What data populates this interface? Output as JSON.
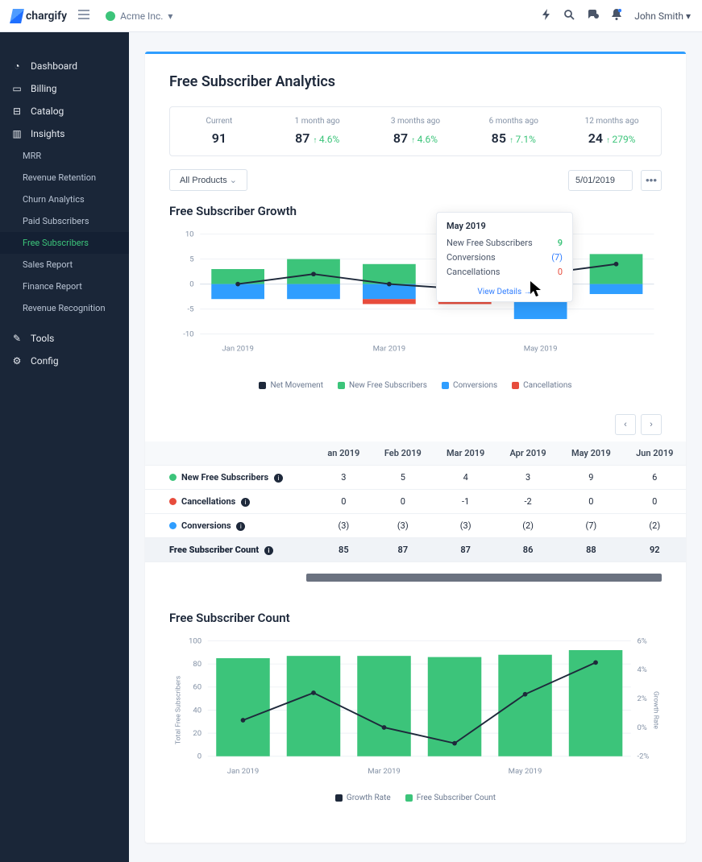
{
  "brand": "chargify",
  "org": "Acme Inc.",
  "user": "John Smith",
  "sidebar": {
    "items": [
      {
        "icon": "dashboard",
        "label": "Dashboard"
      },
      {
        "icon": "billing",
        "label": "Billing"
      },
      {
        "icon": "catalog",
        "label": "Catalog"
      },
      {
        "icon": "insights",
        "label": "Insights"
      },
      {
        "icon": "tools",
        "label": "Tools"
      },
      {
        "icon": "config",
        "label": "Config"
      }
    ],
    "insights_subs": [
      "MRR",
      "Revenue Retention",
      "Churn Analytics",
      "Paid Subscribers",
      "Free Subscribers",
      "Sales Report",
      "Finance Report",
      "Revenue Recognition"
    ]
  },
  "page": {
    "title": "Free Subscriber Analytics"
  },
  "kpis": [
    {
      "label": "Current",
      "value": "91",
      "delta": ""
    },
    {
      "label": "1 month ago",
      "value": "87",
      "delta": "4.6%"
    },
    {
      "label": "3 months ago",
      "value": "87",
      "delta": "4.6%"
    },
    {
      "label": "6 months ago",
      "value": "85",
      "delta": "7.1%"
    },
    {
      "label": "12 months ago",
      "value": "24",
      "delta": "279%"
    }
  ],
  "filters": {
    "products": "All Products",
    "date_end": "5/01/2019"
  },
  "growth": {
    "title": "Free Subscriber Growth",
    "legend": [
      "Net Movement",
      "New Free Subscribers",
      "Conversions",
      "Cancellations"
    ]
  },
  "tooltip": {
    "title": "May 2019",
    "rows": [
      {
        "label": "New Free Subscribers",
        "value": "9",
        "cls": "green"
      },
      {
        "label": "Conversions",
        "value": "(7)",
        "cls": "blue"
      },
      {
        "label": "Cancellations",
        "value": "0",
        "cls": "red"
      }
    ],
    "link": "View Details →"
  },
  "table": {
    "cols": [
      "an 2019",
      "Feb 2019",
      "Mar 2019",
      "Apr 2019",
      "May 2019",
      "Jun 2019"
    ],
    "rows": [
      {
        "label": "New Free Subscribers",
        "color": "#3cc47a",
        "vals": [
          "3",
          "5",
          "4",
          "3",
          "9",
          "6"
        ]
      },
      {
        "label": "Cancellations",
        "color": "#e74c3c",
        "vals": [
          "0",
          "0",
          "-1",
          "-2",
          "0",
          "0"
        ]
      },
      {
        "label": "Conversions",
        "color": "#2f9eff",
        "vals": [
          "(3)",
          "(3)",
          "(3)",
          "(2)",
          "(7)",
          "(2)"
        ]
      }
    ],
    "total_label": "Free Subscriber Count",
    "totals": [
      "85",
      "87",
      "87",
      "86",
      "88",
      "92"
    ]
  },
  "count_chart": {
    "title": "Free Subscriber Count",
    "legend": [
      "Growth Rate",
      "Free Subscriber Count"
    ],
    "ylabel": "Total Free Subscribers",
    "ylabel2": "Growth Rate"
  },
  "chart_data": [
    {
      "type": "bar",
      "title": "Free Subscriber Growth",
      "categories": [
        "Jan 2019",
        "Feb 2019",
        "Mar 2019",
        "Apr 2019",
        "May 2019",
        "Jun 2019"
      ],
      "ylim": [
        -10,
        10
      ],
      "series": [
        {
          "name": "New Free Subscribers",
          "values": [
            3,
            5,
            4,
            3,
            9,
            6
          ],
          "color": "#3cc47a"
        },
        {
          "name": "Conversions",
          "values": [
            -3,
            -3,
            -3,
            -2,
            -7,
            -2
          ],
          "color": "#2f9eff"
        },
        {
          "name": "Cancellations",
          "values": [
            0,
            0,
            -1,
            -2,
            0,
            0
          ],
          "color": "#e74c3c"
        },
        {
          "name": "Net Movement",
          "type": "line",
          "values": [
            0,
            2,
            0,
            -1,
            2,
            4
          ],
          "color": "#1e293b"
        }
      ],
      "xlabel": "",
      "ylabel": ""
    },
    {
      "type": "bar",
      "title": "Free Subscriber Count",
      "categories": [
        "Jan 2019",
        "Feb 2019",
        "Mar 2019",
        "Apr 2019",
        "May 2019",
        "Jun 2019"
      ],
      "ylim": [
        0,
        100
      ],
      "y2lim": [
        -2,
        6
      ],
      "series": [
        {
          "name": "Free Subscriber Count",
          "values": [
            85,
            87,
            87,
            86,
            88,
            92
          ],
          "color": "#3cc47a"
        },
        {
          "name": "Growth Rate",
          "type": "line",
          "axis": "y2",
          "values": [
            0.5,
            2.4,
            0.0,
            -1.1,
            2.3,
            4.5
          ],
          "color": "#1e293b"
        }
      ],
      "xlabel": "",
      "ylabel": "Total Free Subscribers",
      "ylabel2": "Growth Rate"
    }
  ]
}
